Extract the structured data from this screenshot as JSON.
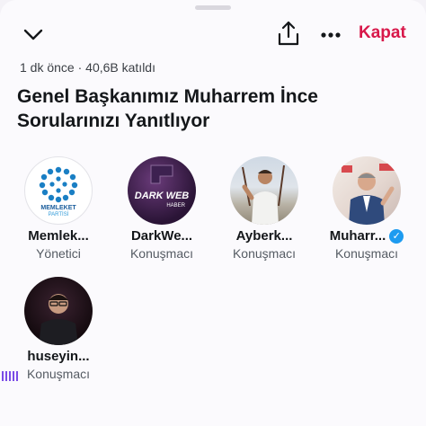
{
  "header": {
    "close_label": "Kapat",
    "icons": [
      "chevron-down-icon",
      "share-icon",
      "more-icon"
    ]
  },
  "space": {
    "meta": "1 dk önce · 40,6B katıldı",
    "title": "Genel Başkanımız Muharrem İnce Sorularınızı Yanıtlıyor"
  },
  "participants": [
    {
      "name": "Memlek...",
      "role": "Yönetici",
      "avatar_text": "MEMLEKET",
      "avatar_sub": "PARTİSİ",
      "verified": false
    },
    {
      "name": "DarkWe...",
      "role": "Konuşmacı",
      "avatar_text": "DARK WEB",
      "avatar_sub": "HABER",
      "verified": false
    },
    {
      "name": "Ayberk...",
      "role": "Konuşmacı",
      "verified": false
    },
    {
      "name": "Muharr...",
      "role": "Konuşmacı",
      "verified": true
    },
    {
      "name": "huseyin...",
      "role": "Konuşmacı",
      "verified": false,
      "speaking": true
    }
  ],
  "colors": {
    "accent": "#d8184a",
    "verified": "#1d9bf0",
    "speaking": "#7a4ce6"
  }
}
